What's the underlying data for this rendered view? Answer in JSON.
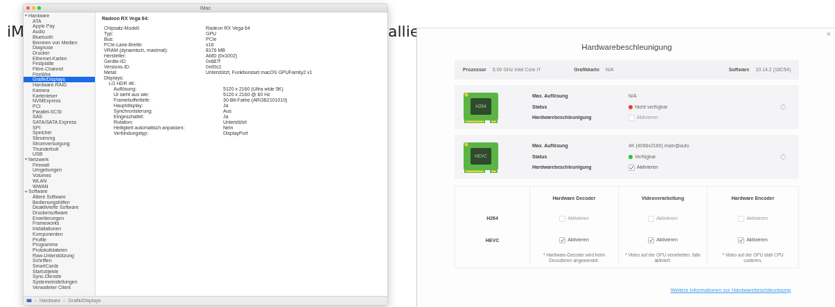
{
  "background_text": [
    "iM",
    "allie"
  ],
  "sysinfo": {
    "title": "iMac",
    "sidebar": [
      {
        "label": "Hardware",
        "expanded": true,
        "children": [
          {
            "label": "ATA",
            "selected": false
          },
          {
            "label": "Apple Pay",
            "selected": false
          },
          {
            "label": "Audio",
            "selected": false
          },
          {
            "label": "Bluetooth",
            "selected": false
          },
          {
            "label": "Brennen von Medien",
            "selected": false
          },
          {
            "label": "Diagnose",
            "selected": false
          },
          {
            "label": "Drucker",
            "selected": false
          },
          {
            "label": "Ethernet-Karten",
            "selected": false
          },
          {
            "label": "Festplatte",
            "selected": false
          },
          {
            "label": "Fibre-Channel",
            "selected": false
          },
          {
            "label": "FireWire",
            "selected": false
          },
          {
            "label": "Grafik/Displays",
            "selected": true
          },
          {
            "label": "Hardware-RAID",
            "selected": false
          },
          {
            "label": "Kamera",
            "selected": false
          },
          {
            "label": "Kartenleser",
            "selected": false
          },
          {
            "label": "NVMExpress",
            "selected": false
          },
          {
            "label": "PCI",
            "selected": false
          },
          {
            "label": "Parallel-SCSI",
            "selected": false
          },
          {
            "label": "SAS",
            "selected": false
          },
          {
            "label": "SATA/SATA Express",
            "selected": false
          },
          {
            "label": "SPI",
            "selected": false
          },
          {
            "label": "Speicher",
            "selected": false
          },
          {
            "label": "Steuerung",
            "selected": false
          },
          {
            "label": "Stromversorgung",
            "selected": false
          },
          {
            "label": "Thunderbolt",
            "selected": false
          },
          {
            "label": "USB",
            "selected": false
          }
        ]
      },
      {
        "label": "Netzwerk",
        "expanded": true,
        "children": [
          {
            "label": "Firewall",
            "selected": false
          },
          {
            "label": "Umgebungen",
            "selected": false
          },
          {
            "label": "Volumes",
            "selected": false
          },
          {
            "label": "WLAN",
            "selected": false
          },
          {
            "label": "WWAN",
            "selected": false
          }
        ]
      },
      {
        "label": "Software",
        "expanded": true,
        "children": [
          {
            "label": "Ältere Software",
            "selected": false
          },
          {
            "label": "Bedienungshilfen",
            "selected": false
          },
          {
            "label": "Deaktivierte Software",
            "selected": false
          },
          {
            "label": "Druckersoftware",
            "selected": false
          },
          {
            "label": "Erweiterungen",
            "selected": false
          },
          {
            "label": "Frameworks",
            "selected": false
          },
          {
            "label": "Installationen",
            "selected": false
          },
          {
            "label": "Komponenten",
            "selected": false
          },
          {
            "label": "Profile",
            "selected": false
          },
          {
            "label": "Programme",
            "selected": false
          },
          {
            "label": "Protokolldateien",
            "selected": false
          },
          {
            "label": "Raw-Unterstützung",
            "selected": false
          },
          {
            "label": "Schriften",
            "selected": false
          },
          {
            "label": "SmartCards",
            "selected": false
          },
          {
            "label": "Startobjekte",
            "selected": false
          },
          {
            "label": "Sync-Dienste",
            "selected": false
          },
          {
            "label": "Systemeinstellungen",
            "selected": false
          },
          {
            "label": "Verwalteter Client",
            "selected": false
          }
        ]
      }
    ],
    "detail": {
      "heading": "Radeon RX Vega 64:",
      "rows": [
        {
          "label": "Chipsatz-Modell:",
          "value": "Radeon RX Vega 64"
        },
        {
          "label": "Typ:",
          "value": "GPU"
        },
        {
          "label": "Bus:",
          "value": "PCIe"
        },
        {
          "label": "PCIe-Lane-Breite:",
          "value": "x16"
        },
        {
          "label": "VRAM (dynamisch, maximal):",
          "value": "8176 MB"
        },
        {
          "label": "Hersteller:",
          "value": "AMD (0x1002)"
        },
        {
          "label": "Geräte-ID:",
          "value": "0x687f"
        },
        {
          "label": "Versions-ID:",
          "value": "0x00c1"
        },
        {
          "label": "Metal:",
          "value": "Unterstützt, Funktionsset macOS GPUFamily2 v1"
        },
        {
          "label": "Displays:",
          "children": [
            {
              "label": "LG HDR 4K:",
              "children": [
                {
                  "label": "Auflösung:",
                  "value": "5120 x 2160 (Ultra wide 5K)"
                },
                {
                  "label": "UI sieht aus wie:",
                  "value": "5120 x 2160 @ 60 Hz"
                },
                {
                  "label": "Framebuffertiefe:",
                  "value": "30-Bit-Farbe (ARGB2101010)"
                },
                {
                  "label": "Hauptdisplay:",
                  "value": "Ja"
                },
                {
                  "label": "Synchronisierung:",
                  "value": "Aus"
                },
                {
                  "label": "Eingeschaltet:",
                  "value": "Ja"
                },
                {
                  "label": "Rotation:",
                  "value": "Unterstützt"
                },
                {
                  "label": "Helligkeit automatisch anpassen:",
                  "value": "Nein"
                },
                {
                  "label": "Verbindungstyp:",
                  "value": "DisplayPort"
                }
              ]
            }
          ]
        }
      ]
    },
    "path": [
      "Hardware",
      "Grafik/Displays"
    ]
  },
  "dialog": {
    "close": "×",
    "title": "Hardwarebeschleunigung",
    "info": [
      {
        "label": "Prozessor",
        "value": "5.00 GHz Intel Core i7"
      },
      {
        "label": "Grafikkarte",
        "value": "N/A"
      },
      {
        "label": "Software",
        "value": "10.14.2 (18C54)"
      }
    ],
    "codecs": [
      {
        "chip": "H264",
        "resolution_label": "Max. Auflösung",
        "resolution": "N/A",
        "status_label": "Status",
        "status": "Nicht verfügbar",
        "available": false,
        "accel_label": "Hardwarebeschleunigung",
        "checkbox": {
          "label": "Aktivieren",
          "checked": false,
          "disabled": true
        }
      },
      {
        "chip": "HEVC",
        "resolution_label": "Max. Auflösung",
        "resolution": "4K (4096x2160) main@auto",
        "status_label": "Status",
        "status": "Verfügbar",
        "available": true,
        "accel_label": "Hardwarebeschleunigung",
        "checkbox": {
          "label": "Aktivieren",
          "checked": true,
          "disabled": false
        }
      }
    ],
    "table": {
      "columns": [
        "Hardware Decoder",
        "Videoverarbeitung",
        "Hardware Encoder"
      ],
      "rows": [
        {
          "label": "H264",
          "cells": [
            {
              "label": "Aktivieren",
              "checked": false,
              "disabled": true
            },
            {
              "label": "Aktivieren",
              "checked": false,
              "disabled": true
            },
            {
              "label": "Aktivieren",
              "checked": false,
              "disabled": true
            }
          ]
        },
        {
          "label": "HEVC",
          "cells": [
            {
              "label": "Aktivieren",
              "checked": true,
              "disabled": false
            },
            {
              "label": "Aktivieren",
              "checked": true,
              "disabled": false
            },
            {
              "label": "Aktivieren",
              "checked": true,
              "disabled": false
            }
          ]
        }
      ],
      "notes": [
        "* Hardware-Decoder wird beim Decodieren angewendet.",
        "* Video auf der GPU verarbeiten, falls aktiviert.",
        "* Video auf der GPU statt CPU codieren."
      ]
    },
    "link": "Weitere Informationen zur Hardwarebeschleunigung"
  }
}
